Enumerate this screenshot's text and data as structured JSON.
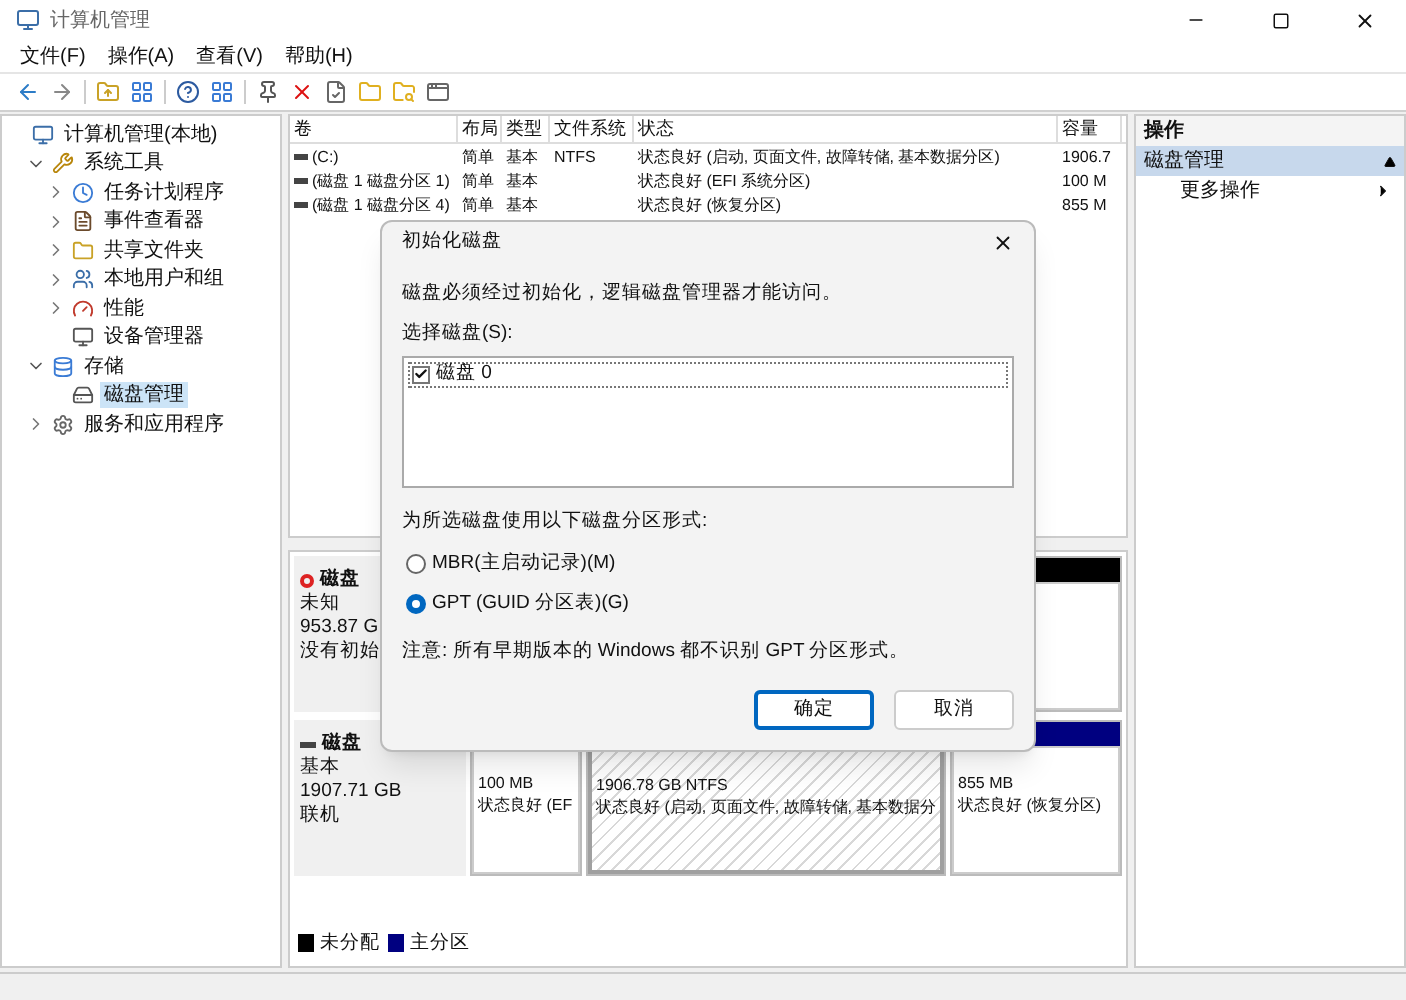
{
  "window": {
    "title": "计算机管理"
  },
  "menu": [
    "文件(F)",
    "操作(A)",
    "查看(V)",
    "帮助(H)"
  ],
  "tree": [
    {
      "label": "计算机管理(本地)",
      "selected": false,
      "children": [
        {
          "label": "系统工具",
          "expanded": true,
          "selected": false,
          "children": [
            {
              "label": "任务计划程序",
              "expanded": false,
              "selected": false
            },
            {
              "label": "事件查看器",
              "expanded": false,
              "selected": false
            },
            {
              "label": "共享文件夹",
              "expanded": false,
              "selected": false
            },
            {
              "label": "本地用户和组",
              "expanded": false,
              "selected": false
            },
            {
              "label": "性能",
              "expanded": false,
              "selected": false
            },
            {
              "label": "设备管理器",
              "selected": false
            }
          ]
        },
        {
          "label": "存储",
          "expanded": true,
          "selected": false,
          "children": [
            {
              "label": "磁盘管理",
              "selected": true
            }
          ]
        },
        {
          "label": "服务和应用程序",
          "expanded": false,
          "selected": false
        }
      ]
    }
  ],
  "volumes": {
    "columns": [
      "卷",
      "布局",
      "类型",
      "文件系统",
      "状态",
      "容量"
    ],
    "rows": [
      [
        "(C:)",
        "简单",
        "基本",
        "NTFS",
        "状态良好 (启动, 页面文件, 故障转储, 基本数据分区)",
        "1906.7"
      ],
      [
        "(磁盘 1 磁盘分区 1)",
        "简单",
        "基本",
        "",
        "状态良好 (EFI 系统分区)",
        "100 M"
      ],
      [
        "(磁盘 1 磁盘分区 4)",
        "简单",
        "基本",
        "",
        "状态良好 (恢复分区)",
        "855 M"
      ]
    ]
  },
  "disks": [
    {
      "name": "磁盘",
      "kind": "unknown",
      "lines": [
        "未知",
        "953.87 G",
        "没有初始"
      ],
      "partitions": [
        {
          "kind": "unallocated"
        }
      ]
    },
    {
      "name": "磁盘",
      "kind": "basic",
      "lines": [
        "基本",
        "1907.71 GB",
        "联机"
      ],
      "partitions": [
        {
          "kind": "primary",
          "lines": [
            "100 MB",
            "状态良好 (EF"
          ]
        },
        {
          "kind": "primary-active",
          "lines": [
            "1906.78 GB NTFS",
            "状态良好 (启动, 页面文件, 故障转储, 基本数据分"
          ]
        },
        {
          "kind": "primary",
          "lines": [
            "855 MB",
            "状态良好 (恢复分区)"
          ]
        }
      ]
    }
  ],
  "legend": [
    {
      "label": "未分配",
      "color": "#000000"
    },
    {
      "label": "主分区",
      "color": "#000080"
    }
  ],
  "actions": {
    "title": "操作",
    "section": {
      "label": "磁盘管理",
      "expanded": true
    },
    "items": [
      "更多操作"
    ]
  },
  "dialog": {
    "title": "初始化磁盘",
    "message": "磁盘必须经过初始化，逻辑磁盘管理器才能访问。",
    "list_label": "选择磁盘(S):",
    "disks": [
      {
        "label": "磁盘 0",
        "checked": true
      }
    ],
    "style_label": "为所选磁盘使用以下磁盘分区形式:",
    "options": [
      {
        "label": "MBR(主启动记录)(M)",
        "selected": false
      },
      {
        "label": "GPT (GUID 分区表)(G)",
        "selected": true
      }
    ],
    "note": "注意: 所有早期版本的 Windows 都不识别 GPT 分区形式。",
    "buttons": [
      {
        "label": "确定",
        "default": true
      },
      {
        "label": "取消",
        "default": false
      }
    ]
  }
}
